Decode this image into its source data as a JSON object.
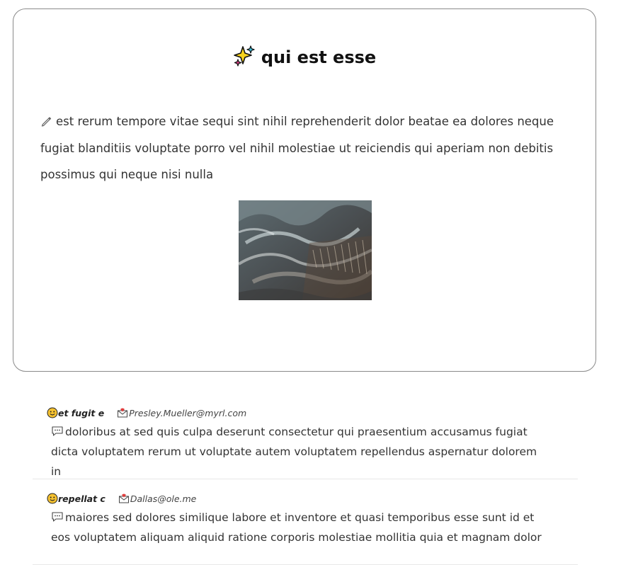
{
  "post": {
    "title": "qui est esse",
    "title_icon": "sparkles-icon",
    "body": "est rerum tempore vitae sequi sint nihil reprehenderit dolor beatae ea dolores neque fugiat blanditiis voluptate porro vel nihil molestiae ut reiciendis qui aperiam non debitis possimus qui neque nisi nulla",
    "body_icon": "pen-icon",
    "image_icon": "photo-image"
  },
  "comments": [
    {
      "name": "et fugit e",
      "email": "Presley.Mueller@myrl.com",
      "body": "doloribus at sed quis culpa deserunt consectetur qui praesentium accusamus fugiat dicta voluptatem rerum ut voluptate autem voluptatem repellendus aspernatur dolorem in"
    },
    {
      "name": "repellat c",
      "email": "Dallas@ole.me",
      "body": "maiores sed dolores similique labore et inventore et quasi temporibus esse sunt id et eos voluptatem aliquam aliquid ratione corporis molestiae mollitia quia et magnam dolor"
    }
  ],
  "colors": {
    "card_border": "#8a8a8a",
    "text": "#333333",
    "divider": "#e8e8e8"
  }
}
